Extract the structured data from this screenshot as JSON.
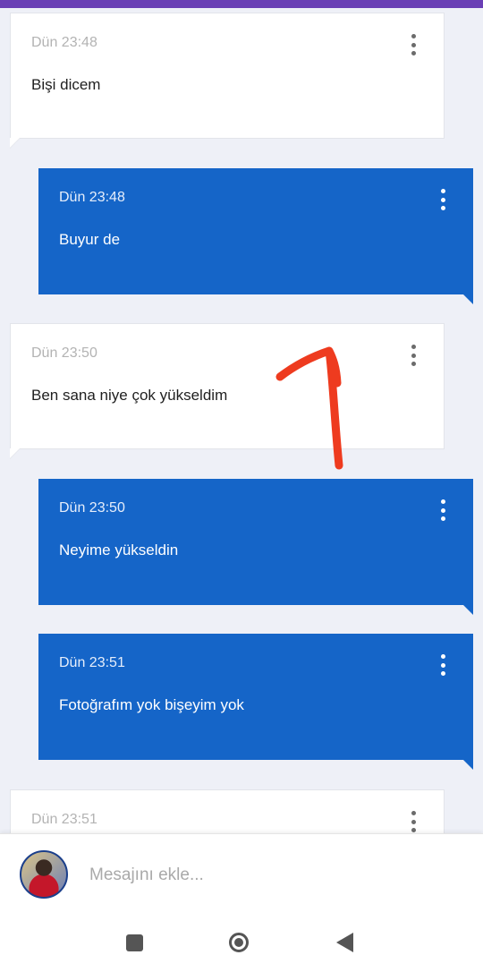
{
  "messages": [
    {
      "direction": "incoming",
      "time": "Dün 23:48",
      "text": "Bişi dicem"
    },
    {
      "direction": "outgoing",
      "time": "Dün 23:48",
      "text": "Buyur de"
    },
    {
      "direction": "incoming",
      "time": "Dün 23:50",
      "text": "Ben sana niye çok yükseldim"
    },
    {
      "direction": "outgoing",
      "time": "Dün 23:50",
      "text": "Neyime yükseldin"
    },
    {
      "direction": "outgoing",
      "time": "Dün 23:51",
      "text": "Fotoğrafım yok bişeyim yok"
    },
    {
      "direction": "incoming",
      "time": "Dün 23:51",
      "text": ""
    }
  ],
  "composer": {
    "placeholder": "Mesajını ekle...",
    "avatar_icon": "user-avatar"
  },
  "colors": {
    "top_accent": "#6a3fb5",
    "outgoing_bubble": "#1565c8",
    "incoming_bubble": "#ffffff",
    "background": "#eef0f7",
    "annotation_stroke": "#ee3b1f"
  },
  "nav_bar": {
    "icons": [
      "recents-icon",
      "home-icon",
      "back-icon"
    ]
  }
}
